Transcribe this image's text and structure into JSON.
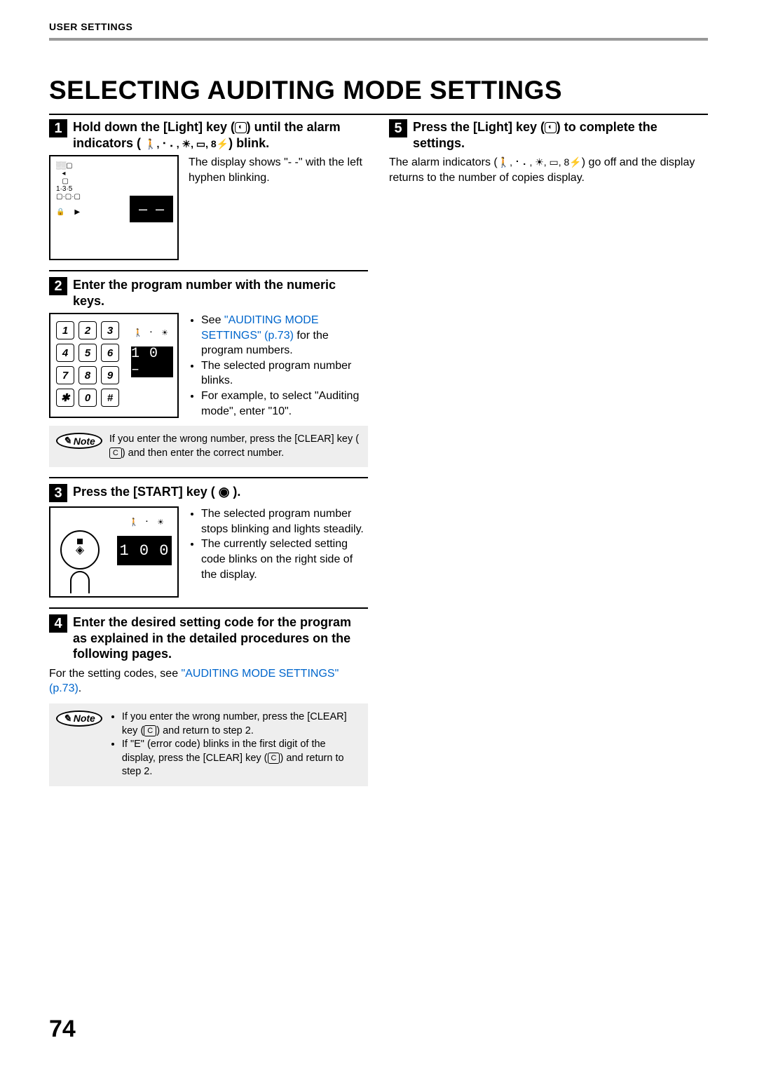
{
  "header": {
    "section": "USER SETTINGS"
  },
  "page_title": "SELECTING AUDITING MODE SETTINGS",
  "page_number": "74",
  "steps": {
    "s1": {
      "num": "1",
      "title_a": "Hold down the [Light] key (",
      "title_b": ") until the alarm indicators (",
      "title_c": ") blink.",
      "indicator_icons": "🚶, ⠂⠄, ☀, ▭, 8⚡",
      "body": "The display shows \"- -\" with the left hyphen blinking.",
      "lcd": "– –"
    },
    "s2": {
      "num": "2",
      "title": "Enter the program number with the numeric keys.",
      "bullet1a": "See ",
      "bullet1_link": "\"AUDITING MODE SETTINGS\" (p.73)",
      "bullet1b": " for the program numbers.",
      "bullet2": "The selected program number blinks.",
      "bullet3": "For example, to select \"Auditing mode\", enter \"10\".",
      "keys": [
        "1",
        "2",
        "3",
        "4",
        "5",
        "6",
        "7",
        "8",
        "9",
        "✱",
        "0",
        "#"
      ],
      "lcd": "1 0 –",
      "note": {
        "label": "Note",
        "text_a": "If you enter the wrong number, press the [CLEAR] key (",
        "clear": "C",
        "text_b": ") and then enter the correct number."
      }
    },
    "s3": {
      "num": "3",
      "title": "Press the [START] key ( ◉ ).",
      "bullet1": "The selected program number stops blinking and lights steadily.",
      "bullet2": "The currently selected setting code blinks on the right side of the display.",
      "lcd": "1 0 0"
    },
    "s4": {
      "num": "4",
      "title": "Enter the desired setting code for the program as explained in the detailed procedures on the following pages.",
      "body_a": "For the setting codes, see ",
      "body_link": "\"AUDITING MODE SETTINGS\" (p.73)",
      "body_b": ".",
      "note": {
        "label": "Note",
        "b1a": "If you enter the wrong number, press the [CLEAR] key (",
        "clear": "C",
        "b1b": ") and return to step 2.",
        "b2a": "If \"E\" (error code) blinks in the first digit of the display, press the [CLEAR] key (",
        "b2b": ") and return to step 2."
      }
    },
    "s5": {
      "num": "5",
      "title_a": "Press the [Light] key (",
      "title_b": ") to complete the settings.",
      "body_a": "The alarm indicators (",
      "indicator_icons": "🚶, ⠂⠄, ☀, ▭, 8⚡",
      "body_b": ") go off and the display returns to the number of copies display."
    }
  }
}
